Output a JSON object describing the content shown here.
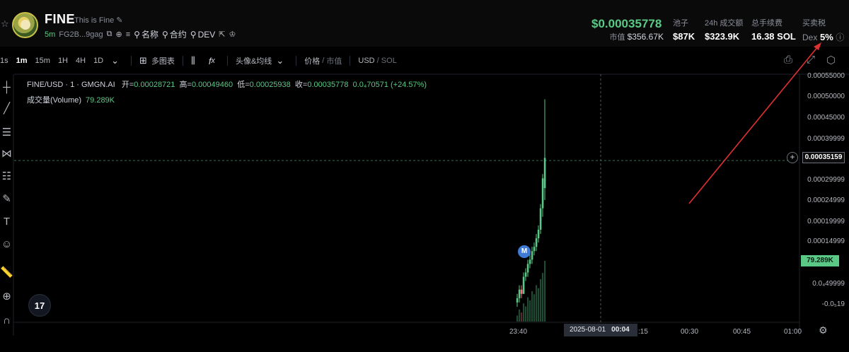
{
  "token": {
    "name": "FINE",
    "description": "This is Fine",
    "age": "5m",
    "address": "FG2B...9gag",
    "links": [
      {
        "label": "名称"
      },
      {
        "label": "合约"
      },
      {
        "label": "DEV"
      }
    ]
  },
  "stats": {
    "price": "$0.00035778",
    "market_cap_label": "市值",
    "market_cap": "$356.67K",
    "pool_label": "池子",
    "pool": "$87K",
    "volume24h_label": "24h 成交额",
    "volume24h": "$323.9K",
    "fees_label": "总手续费",
    "fees": "16.38 SOL",
    "tax_label": "买卖税",
    "tax_dex": "Dex",
    "tax_value": "5%"
  },
  "toolbar": {
    "timeframes": [
      "1s",
      "1m",
      "15m",
      "1H",
      "4H",
      "1D"
    ],
    "active_timeframe": "1m",
    "multi_chart": "多图表",
    "indicators": "头像&均线",
    "price_label": "价格",
    "mcap_label": "市值",
    "currency_usd": "USD",
    "currency_sol": "SOL"
  },
  "legend": {
    "symbol": "FINE/USD · 1 · GMGN.AI",
    "open_label": "开=",
    "open": "0.00028721",
    "high_label": "高=",
    "high": "0.00049460",
    "low_label": "低=",
    "low": "0.00025938",
    "close_label": "收=",
    "close": "0.00035778",
    "change": "0.0₄70571 (+24.57%)",
    "volume_label": "成交量(Volume)",
    "volume": "79.289K"
  },
  "chart_data": {
    "type": "candlestick",
    "y_ticks": [
      "0.00055000",
      "0.00050000",
      "0.00045000",
      "0.00039999",
      "0.00029999",
      "0.00024999",
      "0.00019999",
      "0.00014999",
      "79.289K",
      "0.0₄49999",
      "-0.0₅19"
    ],
    "x_ticks": [
      "23:40",
      ":15",
      "00:30",
      "00:45",
      "01:00"
    ],
    "crosshair_price": "0.00035159",
    "crosshair_date": "2025-08-01",
    "crosshair_time": "00:04",
    "volume_tag": "79.289K",
    "marker": "M",
    "candles": [
      {
        "o": 2e-05,
        "h": 4e-05,
        "l": 1e-05,
        "c": 3e-05,
        "up": true
      },
      {
        "o": 3e-05,
        "h": 6e-05,
        "l": 2e-05,
        "c": 5e-05,
        "up": true
      },
      {
        "o": 5e-05,
        "h": 6e-05,
        "l": 3e-05,
        "c": 4e-05,
        "up": false
      },
      {
        "o": 4e-05,
        "h": 9e-05,
        "l": 4e-05,
        "c": 8e-05,
        "up": true
      },
      {
        "o": 8e-05,
        "h": 0.0001,
        "l": 7e-05,
        "c": 9e-05,
        "up": true
      },
      {
        "o": 9e-05,
        "h": 0.00012,
        "l": 8e-05,
        "c": 0.00011,
        "up": true
      },
      {
        "o": 0.00011,
        "h": 0.00014,
        "l": 0.0001,
        "c": 0.00012,
        "up": true
      },
      {
        "o": 0.00012,
        "h": 0.00015,
        "l": 0.00011,
        "c": 0.00014,
        "up": true
      },
      {
        "o": 0.00014,
        "h": 0.00016,
        "l": 0.00013,
        "c": 0.00015,
        "up": true
      },
      {
        "o": 0.00015,
        "h": 0.00018,
        "l": 0.00014,
        "c": 0.00017,
        "up": true
      },
      {
        "o": 0.00017,
        "h": 0.0002,
        "l": 0.00016,
        "c": 0.00019,
        "up": true
      },
      {
        "o": 0.00019,
        "h": 0.00025,
        "l": 0.00018,
        "c": 0.00024,
        "up": true
      },
      {
        "o": 0.00024,
        "h": 0.00032,
        "l": 0.00022,
        "c": 0.00031,
        "up": true
      },
      {
        "o": 0.00028721,
        "h": 0.0004946,
        "l": 0.00025938,
        "c": 0.00035778,
        "up": true
      }
    ],
    "volumes": [
      0.1,
      0.2,
      0.15,
      0.3,
      0.25,
      0.4,
      0.35,
      0.5,
      0.45,
      0.6,
      0.55,
      0.7,
      0.8,
      1.0
    ]
  },
  "colors": {
    "up": "#5ac985",
    "down": "#f26d7d",
    "annotation_arrow": "#e03131"
  }
}
